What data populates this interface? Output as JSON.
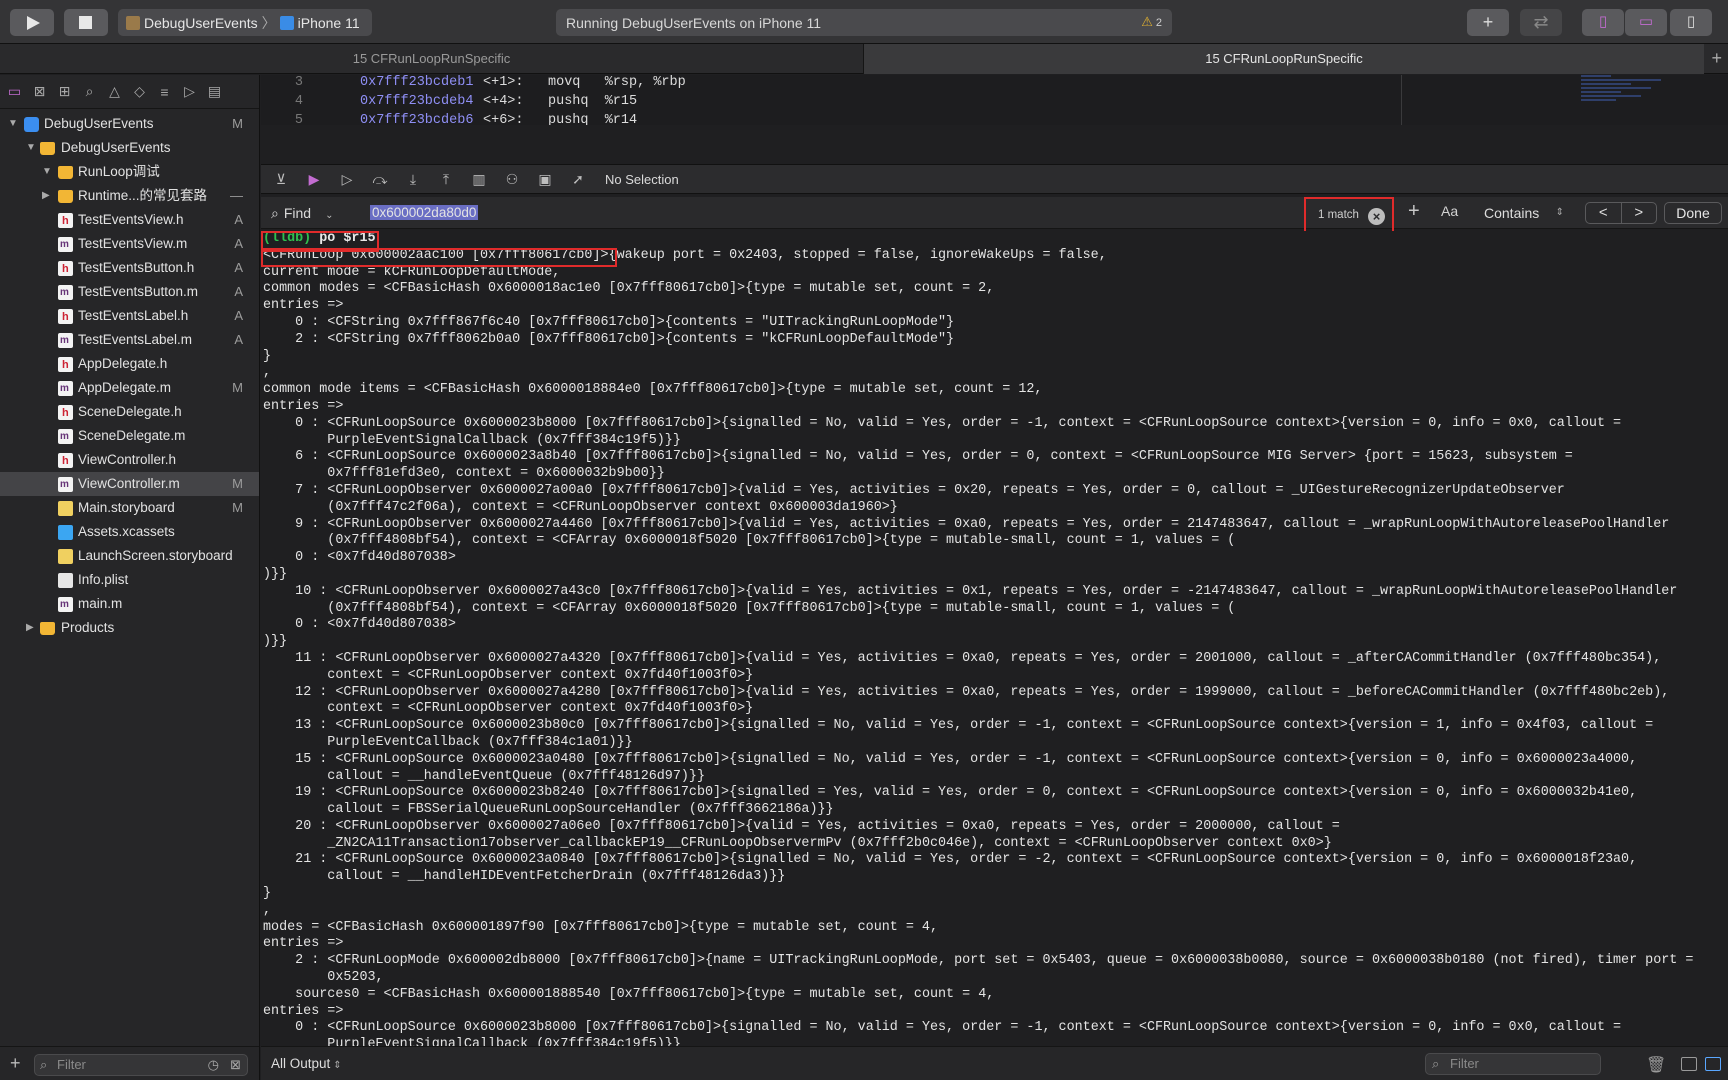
{
  "toolbar": {
    "scheme": "DebugUserEvents",
    "device": "iPhone 11",
    "status": "Running DebugUserEvents on iPhone 11",
    "warning_count": "2"
  },
  "tabs": [
    "15 CFRunLoopRunSpecific",
    "15 CFRunLoopRunSpecific"
  ],
  "navigator": {
    "items": [
      {
        "label": "DebugUserEvents",
        "badge": "M"
      },
      {
        "label": "DebugUserEvents",
        "badge": ""
      },
      {
        "label": "RunLoop调试",
        "badge": ""
      },
      {
        "label": "Runtime...的常见套路",
        "badge": "—"
      },
      {
        "label": "TestEventsView.h",
        "badge": "A"
      },
      {
        "label": "TestEventsView.m",
        "badge": "A"
      },
      {
        "label": "TestEventsButton.h",
        "badge": "A"
      },
      {
        "label": "TestEventsButton.m",
        "badge": "A"
      },
      {
        "label": "TestEventsLabel.h",
        "badge": "A"
      },
      {
        "label": "TestEventsLabel.m",
        "badge": "A"
      },
      {
        "label": "AppDelegate.h",
        "badge": ""
      },
      {
        "label": "AppDelegate.m",
        "badge": "M"
      },
      {
        "label": "SceneDelegate.h",
        "badge": ""
      },
      {
        "label": "SceneDelegate.m",
        "badge": ""
      },
      {
        "label": "ViewController.h",
        "badge": ""
      },
      {
        "label": "ViewController.m",
        "badge": "M"
      },
      {
        "label": "Main.storyboard",
        "badge": "M"
      },
      {
        "label": "Assets.xcassets",
        "badge": ""
      },
      {
        "label": "LaunchScreen.storyboard",
        "badge": ""
      },
      {
        "label": "Info.plist",
        "badge": ""
      },
      {
        "label": "main.m",
        "badge": ""
      },
      {
        "label": "Products",
        "badge": ""
      }
    ],
    "filter_placeholder": "Filter"
  },
  "code": {
    "lines": [
      {
        "num": "3",
        "addr": "0x7fff23bcdeb1",
        "offset": "<+1>:",
        "ins": "movq   %rsp, %rbp"
      },
      {
        "num": "4",
        "addr": "0x7fff23bcdeb4",
        "offset": "<+4>:",
        "ins": "pushq  %r15"
      },
      {
        "num": "5",
        "addr": "0x7fff23bcdeb6",
        "offset": "<+6>:",
        "ins": "pushq  %r14"
      }
    ]
  },
  "debugbar": {
    "selection": "No Selection"
  },
  "findbar": {
    "mode": "Find",
    "query": "0x600002da80d0",
    "match_count": "1 match",
    "case_toggle": "Aa",
    "match_type": "Contains",
    "done": "Done",
    "prev": "<",
    "next": ">"
  },
  "console": {
    "prompt": "(lldb)",
    "command": "po $r15",
    "output": "<CFRunLoop 0x600002aac100 [0x7fff80617cb0]>{wakeup port = 0x2403, stopped = false, ignoreWakeUps = false, \ncurrent mode = kCFRunLoopDefaultMode,\ncommon modes = <CFBasicHash 0x6000018ac1e0 [0x7fff80617cb0]>{type = mutable set, count = 2,\nentries =>\n\t0 : <CFString 0x7fff867f6c40 [0x7fff80617cb0]>{contents = \"UITrackingRunLoopMode\"}\n\t2 : <CFString 0x7fff8062b0a0 [0x7fff80617cb0]>{contents = \"kCFRunLoopDefaultMode\"}\n}\n,\ncommon mode items = <CFBasicHash 0x6000018884e0 [0x7fff80617cb0]>{type = mutable set, count = 12,\nentries =>\n\t0 : <CFRunLoopSource 0x6000023b8000 [0x7fff80617cb0]>{signalled = No, valid = Yes, order = -1, context = <CFRunLoopSource context>{version = 0, info = 0x0, callout =\n\t    PurpleEventSignalCallback (0x7fff384c19f5)}}\n\t6 : <CFRunLoopSource 0x6000023a8b40 [0x7fff80617cb0]>{signalled = No, valid = Yes, order = 0, context = <CFRunLoopSource MIG Server> {port = 15623, subsystem =\n\t    0x7fff81efd3e0, context = 0x6000032b9b00}}\n\t7 : <CFRunLoopObserver 0x6000027a00a0 [0x7fff80617cb0]>{valid = Yes, activities = 0x20, repeats = Yes, order = 0, callout = _UIGestureRecognizerUpdateObserver\n\t    (0x7fff47c2f06a), context = <CFRunLoopObserver context 0x600003da1960>}\n\t9 : <CFRunLoopObserver 0x6000027a4460 [0x7fff80617cb0]>{valid = Yes, activities = 0xa0, repeats = Yes, order = 2147483647, callout = _wrapRunLoopWithAutoreleasePoolHandler\n\t    (0x7fff4808bf54), context = <CFArray 0x6000018f5020 [0x7fff80617cb0]>{type = mutable-small, count = 1, values = (\n\t0 : <0x7fd40d807038>\n)}}\n\t10 : <CFRunLoopObserver 0x6000027a43c0 [0x7fff80617cb0]>{valid = Yes, activities = 0x1, repeats = Yes, order = -2147483647, callout = _wrapRunLoopWithAutoreleasePoolHandler\n\t    (0x7fff4808bf54), context = <CFArray 0x6000018f5020 [0x7fff80617cb0]>{type = mutable-small, count = 1, values = (\n\t0 : <0x7fd40d807038>\n)}}\n\t11 : <CFRunLoopObserver 0x6000027a4320 [0x7fff80617cb0]>{valid = Yes, activities = 0xa0, repeats = Yes, order = 2001000, callout = _afterCACommitHandler (0x7fff480bc354),\n\t    context = <CFRunLoopObserver context 0x7fd40f1003f0>}\n\t12 : <CFRunLoopObserver 0x6000027a4280 [0x7fff80617cb0]>{valid = Yes, activities = 0xa0, repeats = Yes, order = 1999000, callout = _beforeCACommitHandler (0x7fff480bc2eb),\n\t    context = <CFRunLoopObserver context 0x7fd40f1003f0>}\n\t13 : <CFRunLoopSource 0x6000023b80c0 [0x7fff80617cb0]>{signalled = No, valid = Yes, order = -1, context = <CFRunLoopSource context>{version = 1, info = 0x4f03, callout =\n\t    PurpleEventCallback (0x7fff384c1a01)}}\n\t15 : <CFRunLoopSource 0x6000023a0480 [0x7fff80617cb0]>{signalled = No, valid = Yes, order = -1, context = <CFRunLoopSource context>{version = 0, info = 0x6000023a4000,\n\t    callout = __handleEventQueue (0x7fff48126d97)}}\n\t19 : <CFRunLoopSource 0x6000023b8240 [0x7fff80617cb0]>{signalled = Yes, valid = Yes, order = 0, context = <CFRunLoopSource context>{version = 0, info = 0x6000032b41e0,\n\t    callout = FBSSerialQueueRunLoopSourceHandler (0x7fff3662186a)}}\n\t20 : <CFRunLoopObserver 0x6000027a06e0 [0x7fff80617cb0]>{valid = Yes, activities = 0xa0, repeats = Yes, order = 2000000, callout =\n\t    _ZN2CA11Transaction17observer_callbackEP19__CFRunLoopObservermPv (0x7fff2b0c046e), context = <CFRunLoopObserver context 0x0>}\n\t21 : <CFRunLoopSource 0x6000023a0840 [0x7fff80617cb0]>{signalled = No, valid = Yes, order = -2, context = <CFRunLoopSource context>{version = 0, info = 0x6000018f23a0,\n\t    callout = __handleHIDEventFetcherDrain (0x7fff48126da3)}}\n}\n,\nmodes = <CFBasicHash 0x600001897f90 [0x7fff80617cb0]>{type = mutable set, count = 4,\nentries =>\n\t2 : <CFRunLoopMode 0x600002db8000 [0x7fff80617cb0]>{name = UITrackingRunLoopMode, port set = 0x5403, queue = 0x6000038b0080, source = 0x6000038b0180 (not fired), timer port =\n\t    0x5203, \n\tsources0 = <CFBasicHash 0x600001888540 [0x7fff80617cb0]>{type = mutable set, count = 4,\nentries =>\n\t0 : <CFRunLoopSource 0x6000023b8000 [0x7fff80617cb0]>{signalled = No, valid = Yes, order = -1, context = <CFRunLoopSource context>{version = 0, info = 0x0, callout =\n\t    PurpleEventSignalCallback (0x7fff384c19f5)}}"
  },
  "bottombar": {
    "output_mode": "All Output",
    "filter_placeholder": "Filter"
  }
}
